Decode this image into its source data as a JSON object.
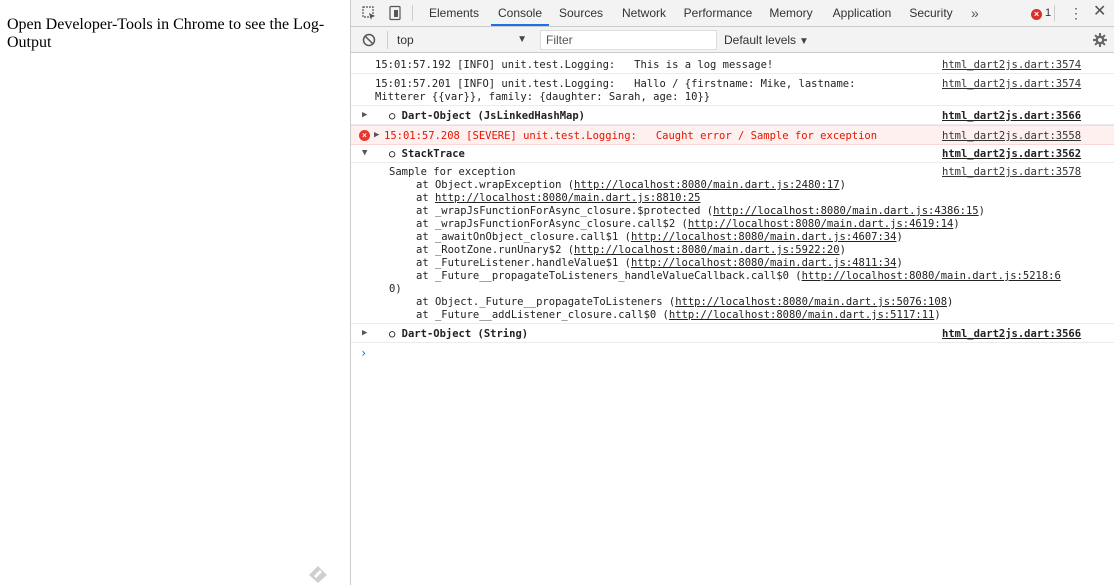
{
  "page": {
    "text": "Open Developer-Tools in Chrome to see the Log-Output"
  },
  "devtools": {
    "tabs": [
      "Elements",
      "Console",
      "Sources",
      "Network",
      "Performance",
      "Memory",
      "Application",
      "Security"
    ],
    "active_tab": "Console",
    "more_tabs_label": "»",
    "error_count": "1",
    "error_badge_icon": "×",
    "close_label": "✕",
    "kebab_label": "⋮"
  },
  "filterbar": {
    "context": "top",
    "filter_placeholder": "Filter",
    "filter_value": "",
    "levels": "Default levels"
  },
  "console": {
    "rows": [
      {
        "msg": "15:01:57.192 [INFO] unit.test.Logging:   This is a log message!",
        "src": "html_dart2js.dart:3574"
      },
      {
        "msg": "15:01:57.201 [INFO] unit.test.Logging:   Hallo / {firstname: Mike, lastname:",
        "msg2": "Mitterer {{var}}, family: {daughter: Sarah, age: 10}}",
        "src": "html_dart2js.dart:3574"
      },
      {
        "prefix": "○ ",
        "msg": "Dart-Object (JsLinkedHashMap)",
        "src": "html_dart2js.dart:3566"
      },
      {
        "msg": "15:01:57.208 [SEVERE] unit.test.Logging:   Caught error / Sample for exception",
        "src": "html_dart2js.dart:3558"
      },
      {
        "prefix": "○ ",
        "msg": "StackTrace",
        "src": "html_dart2js.dart:3562"
      },
      {
        "prefix": "○ ",
        "msg": "Dart-Object (String)",
        "src": "html_dart2js.dart:3566"
      }
    ],
    "trace": {
      "head": "Sample for exception",
      "src": "html_dart2js.dart:3578",
      "lines": [
        {
          "pre": "at Object.wrapException (",
          "link": "http://localhost:8080/main.dart.js:2480:17",
          "post": ")"
        },
        {
          "pre": "at ",
          "link": "http://localhost:8080/main.dart.js:8810:25",
          "post": ""
        },
        {
          "pre": "at _wrapJsFunctionForAsync_closure.$protected (",
          "link": "http://localhost:8080/main.dart.js:4386:15",
          "post": ")"
        },
        {
          "pre": "at _wrapJsFunctionForAsync_closure.call$2 (",
          "link": "http://localhost:8080/main.dart.js:4619:14",
          "post": ")"
        },
        {
          "pre": "at _awaitOnObject_closure.call$1 (",
          "link": "http://localhost:8080/main.dart.js:4607:34",
          "post": ")"
        },
        {
          "pre": "at _RootZone.runUnary$2 (",
          "link": "http://localhost:8080/main.dart.js:5922:20",
          "post": ")"
        },
        {
          "pre": "at _FutureListener.handleValue$1 (",
          "link": "http://localhost:8080/main.dart.js:4811:34",
          "post": ")"
        },
        {
          "pre": "at _Future__propagateToListeners_handleValueCallback.call$0 (",
          "link": "http://localhost:8080/main.dart.js:5218:6",
          "post": ""
        },
        {
          "pre": "",
          "link": "0",
          "post": ")"
        },
        {
          "pre": "at Object._Future__propagateToListeners (",
          "link": "http://localhost:8080/main.dart.js:5076:108",
          "post": ")"
        },
        {
          "pre": "at _Future__addListener_closure.call$0 (",
          "link": "http://localhost:8080/main.dart.js:5117:11",
          "post": ")"
        }
      ]
    },
    "prompt": "›"
  },
  "colors": {
    "accent": "#1a73e8",
    "error": "#e51400",
    "error_bg": "#fff0f0"
  }
}
